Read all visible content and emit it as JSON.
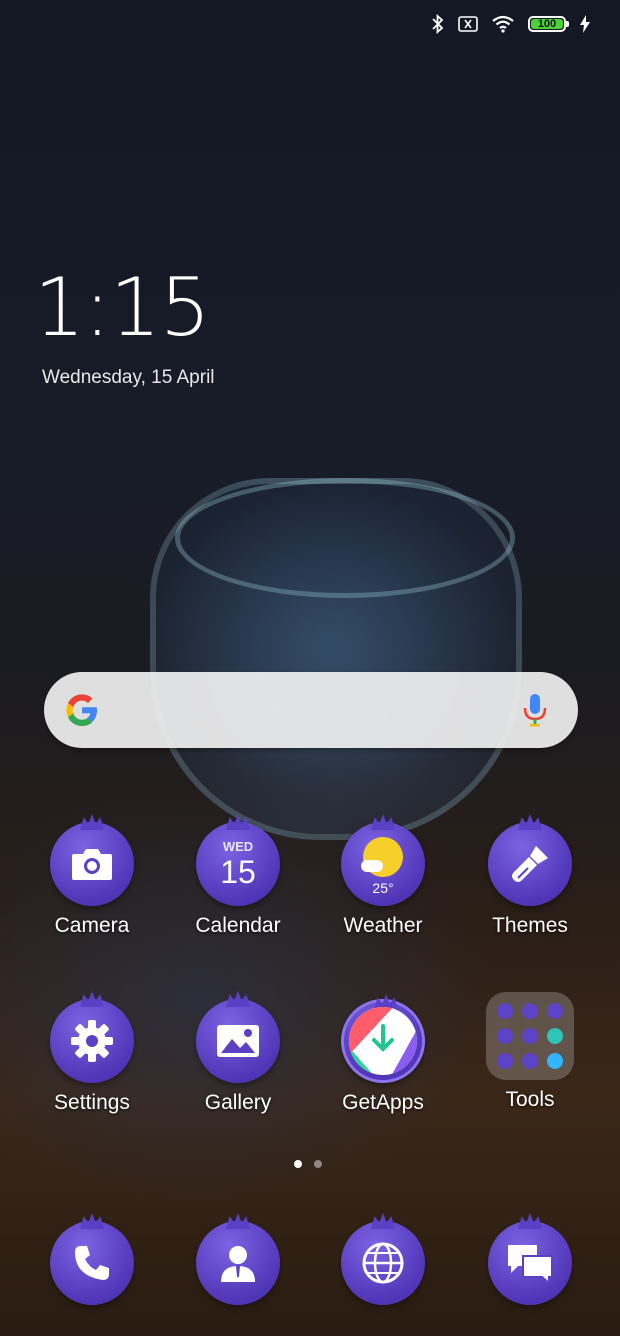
{
  "status_bar": {
    "battery_level": "100",
    "icons": [
      "bluetooth-icon",
      "no-sim-icon",
      "wifi-icon",
      "battery-icon",
      "charging-icon"
    ]
  },
  "lock_clock": {
    "time": "1:15",
    "date": "Wednesday, 15 April"
  },
  "search": {
    "icons": [
      "google-logo-icon",
      "mic-icon"
    ]
  },
  "apps": [
    {
      "label": "Camera",
      "icon": "camera-icon"
    },
    {
      "label": "Calendar",
      "icon": "calendar-icon",
      "day": "WED",
      "date": "15"
    },
    {
      "label": "Weather",
      "icon": "weather-icon",
      "temp": "25°"
    },
    {
      "label": "Themes",
      "icon": "brush-icon"
    },
    {
      "label": "Settings",
      "icon": "gear-icon"
    },
    {
      "label": "Gallery",
      "icon": "gallery-icon"
    },
    {
      "label": "GetApps",
      "icon": "getapps-icon"
    },
    {
      "label": "Tools",
      "icon": "folder-icon"
    }
  ],
  "page_indicator": {
    "pages": 2,
    "current": 1
  },
  "dock": [
    {
      "icon": "phone-icon"
    },
    {
      "icon": "contacts-icon"
    },
    {
      "icon": "browser-icon"
    },
    {
      "icon": "messages-icon"
    }
  ],
  "colors": {
    "icon_purple": "#5a40c4",
    "battery_green": "#4cd137",
    "weather_sun": "#f6cf2b"
  }
}
